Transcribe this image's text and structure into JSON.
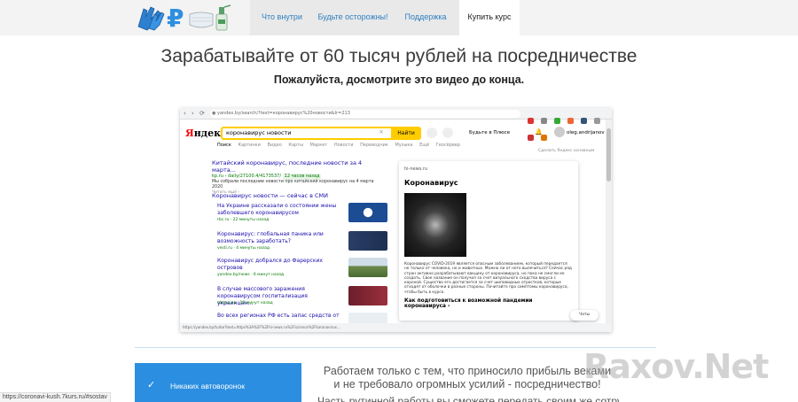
{
  "nav": {
    "items": [
      {
        "label": "Что внутри"
      },
      {
        "label": "Будьте осторожны!"
      },
      {
        "label": "Поддержка"
      },
      {
        "label": "Купить курс"
      }
    ]
  },
  "hero": {
    "headline": "Зарабатывайте от 60 тысяч рублей на посредничестве",
    "subline": "Пожалуйста, досмотрите это видео до конца."
  },
  "video": {
    "address": "yandex.by/search/?text=коронавирус%20новости&lr=213",
    "yandex_logo_red": "Я",
    "yandex_logo_black": "ндекс",
    "query": "коронавирус новости",
    "find_button": "Найти",
    "plus_label": "Будьте в Плюсе",
    "user": "oleg.andrijanov",
    "tabs": [
      "Поиск",
      "Картинки",
      "Видео",
      "Карты",
      "Маркет",
      "Новости",
      "Переводчик",
      "Музыка",
      "Ещё",
      "Геосёрвер"
    ],
    "make_default": "Сделать Яндекс основным",
    "result1": {
      "title": "Китайский коронавирус, последние новости за 4 марта...",
      "url": "kp.ru › daily/27100.4/4173537/",
      "badge": "12 часов назад",
      "text": "Мы собрали последние новости про китайский коронавирус на 4 марта 2020",
      "more": "Читать ещё ›"
    },
    "news_block_title": "Коронавирус новости — сейчас в СМИ",
    "news": [
      {
        "title": "На Украине рассказали о состоянии жены заболевшего коронавирусом",
        "src": "rbc.ru · 22 минуты назад"
      },
      {
        "title": "Коронавирус: глобальная паника или возможность заработать?",
        "src": "vesti.ru · 4 минуты назад"
      },
      {
        "title": "Коронавирус добрался до Фарерских островов",
        "src": "yandex.by/news · 6 минут назад"
      },
      {
        "title": "В случае массового заражения коронавирусом госпитализация украинцам...",
        "src": "strana.ua · 10 минут назад"
      },
      {
        "title": "Во всех регионах РФ есть запас средств от",
        "src": ""
      }
    ],
    "panel": {
      "source": "hi-news.ru",
      "title": "Коронавирус",
      "text": "Коронавирус COVID-2019 является опасным заболеванием, который передается не только от человека, но и животных. Можно ли от него вылечиться? Сейчас ряд стран активно разрабатывают вакцину от коронавируса, но пока не смогли ее создать. Свое название он получил за счет визуального сходства вируса с короной. Существо его достигается за счет шиповидных отростков, которые отходят от оболочки в разные стороны. Почитайте про симптомы коронавируса, чтобы быть в курсе.",
      "question": "Как подготовиться к возможной пандемии коронавируса ›"
    },
    "chat": "Чаты",
    "status_url": "https://yandex.by/turbo?text=https%3A%2F%2Fhi-news.ru%2Fscience%2Fkoronavirus…"
  },
  "features": {
    "item1": "Никаких автоворонок"
  },
  "work": {
    "text": "Работаем только с тем, что приносило прибыль веками и не требовало огромных усилий - посредничество!",
    "text2": "Часть рутинной работы вы сможете передать своим же сотрудникам"
  },
  "watermark": "Raxov.Net",
  "statusbar": {
    "url": "https://coronavi-kush.7kurs.ru/#sostav"
  },
  "colors": {
    "accent": "#2b8ee0",
    "nav_link": "#2d7fc1",
    "yandex_yellow": "#ffcc00"
  }
}
